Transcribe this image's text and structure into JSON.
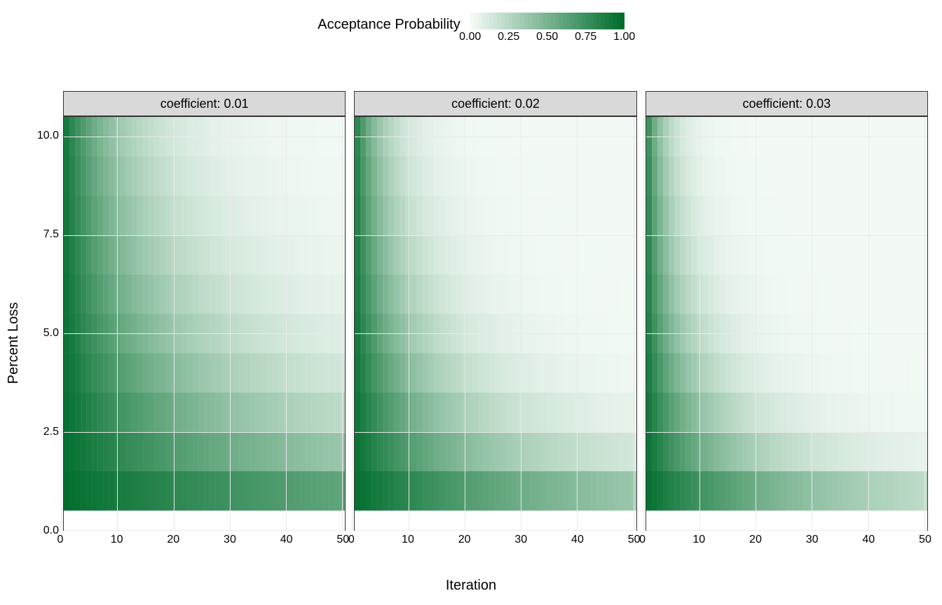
{
  "legend": {
    "title": "Acceptance Probability",
    "ticks": [
      "0.00",
      "0.25",
      "0.50",
      "0.75",
      "1.00"
    ]
  },
  "axes": {
    "ylabel": "Percent Loss",
    "xlabel": "Iteration",
    "yticks": [
      "0.0",
      "2.5",
      "5.0",
      "7.5",
      "10.0"
    ],
    "xticks": [
      "0",
      "10",
      "20",
      "30",
      "40",
      "50"
    ]
  },
  "facets": [
    {
      "label": "coefficient: 0.01",
      "coef": 0.01
    },
    {
      "label": "coefficient: 0.02",
      "coef": 0.02
    },
    {
      "label": "coefficient: 0.03",
      "coef": 0.03
    }
  ],
  "chart_data": {
    "type": "heatmap",
    "xlabel": "Iteration",
    "ylabel": "Percent Loss",
    "zlabel": "Acceptance Probability",
    "x_range": [
      1,
      50
    ],
    "y_values": [
      1,
      2,
      3,
      4,
      5,
      6,
      7,
      8,
      9,
      10
    ],
    "y_axis_limits": [
      0,
      10.5
    ],
    "z_range": [
      0,
      1
    ],
    "formula": "z = exp(-coefficient * x * y)",
    "color_scale": {
      "low": "#f3faf5",
      "high": "#006d2c"
    },
    "panels": [
      {
        "facet": "coefficient: 0.01",
        "coefficient": 0.01,
        "rows": [
          {
            "y": 1,
            "z_at_x1": 0.99,
            "z_at_x10": 0.9,
            "z_at_x25": 0.78,
            "z_at_x50": 0.61
          },
          {
            "y": 2,
            "z_at_x1": 0.98,
            "z_at_x10": 0.82,
            "z_at_x25": 0.61,
            "z_at_x50": 0.37
          },
          {
            "y": 3,
            "z_at_x1": 0.97,
            "z_at_x10": 0.74,
            "z_at_x25": 0.47,
            "z_at_x50": 0.22
          },
          {
            "y": 4,
            "z_at_x1": 0.96,
            "z_at_x10": 0.67,
            "z_at_x25": 0.37,
            "z_at_x50": 0.14
          },
          {
            "y": 5,
            "z_at_x1": 0.95,
            "z_at_x10": 0.61,
            "z_at_x25": 0.29,
            "z_at_x50": 0.08
          },
          {
            "y": 6,
            "z_at_x1": 0.94,
            "z_at_x10": 0.55,
            "z_at_x25": 0.22,
            "z_at_x50": 0.05
          },
          {
            "y": 7,
            "z_at_x1": 0.93,
            "z_at_x10": 0.5,
            "z_at_x25": 0.17,
            "z_at_x50": 0.03
          },
          {
            "y": 8,
            "z_at_x1": 0.92,
            "z_at_x10": 0.45,
            "z_at_x25": 0.14,
            "z_at_x50": 0.02
          },
          {
            "y": 9,
            "z_at_x1": 0.91,
            "z_at_x10": 0.41,
            "z_at_x25": 0.11,
            "z_at_x50": 0.01
          },
          {
            "y": 10,
            "z_at_x1": 0.9,
            "z_at_x10": 0.37,
            "z_at_x25": 0.08,
            "z_at_x50": 0.01
          }
        ]
      },
      {
        "facet": "coefficient: 0.02",
        "coefficient": 0.02,
        "rows": [
          {
            "y": 1,
            "z_at_x1": 0.98,
            "z_at_x10": 0.82,
            "z_at_x25": 0.61,
            "z_at_x50": 0.37
          },
          {
            "y": 2,
            "z_at_x1": 0.96,
            "z_at_x10": 0.67,
            "z_at_x25": 0.37,
            "z_at_x50": 0.14
          },
          {
            "y": 3,
            "z_at_x1": 0.94,
            "z_at_x10": 0.55,
            "z_at_x25": 0.22,
            "z_at_x50": 0.05
          },
          {
            "y": 4,
            "z_at_x1": 0.92,
            "z_at_x10": 0.45,
            "z_at_x25": 0.14,
            "z_at_x50": 0.02
          },
          {
            "y": 5,
            "z_at_x1": 0.9,
            "z_at_x10": 0.37,
            "z_at_x25": 0.08,
            "z_at_x50": 0.01
          },
          {
            "y": 6,
            "z_at_x1": 0.89,
            "z_at_x10": 0.3,
            "z_at_x25": 0.05,
            "z_at_x50": 0.0
          },
          {
            "y": 7,
            "z_at_x1": 0.87,
            "z_at_x10": 0.25,
            "z_at_x25": 0.03,
            "z_at_x50": 0.0
          },
          {
            "y": 8,
            "z_at_x1": 0.85,
            "z_at_x10": 0.2,
            "z_at_x25": 0.02,
            "z_at_x50": 0.0
          },
          {
            "y": 9,
            "z_at_x1": 0.84,
            "z_at_x10": 0.17,
            "z_at_x25": 0.01,
            "z_at_x50": 0.0
          },
          {
            "y": 10,
            "z_at_x1": 0.82,
            "z_at_x10": 0.14,
            "z_at_x25": 0.01,
            "z_at_x50": 0.0
          }
        ]
      },
      {
        "facet": "coefficient: 0.03",
        "coefficient": 0.03,
        "rows": [
          {
            "y": 1,
            "z_at_x1": 0.97,
            "z_at_x10": 0.74,
            "z_at_x25": 0.47,
            "z_at_x50": 0.22
          },
          {
            "y": 2,
            "z_at_x1": 0.94,
            "z_at_x10": 0.55,
            "z_at_x25": 0.22,
            "z_at_x50": 0.05
          },
          {
            "y": 3,
            "z_at_x1": 0.91,
            "z_at_x10": 0.41,
            "z_at_x25": 0.11,
            "z_at_x50": 0.01
          },
          {
            "y": 4,
            "z_at_x1": 0.89,
            "z_at_x10": 0.3,
            "z_at_x25": 0.05,
            "z_at_x50": 0.0
          },
          {
            "y": 5,
            "z_at_x1": 0.86,
            "z_at_x10": 0.22,
            "z_at_x25": 0.02,
            "z_at_x50": 0.0
          },
          {
            "y": 6,
            "z_at_x1": 0.84,
            "z_at_x10": 0.17,
            "z_at_x25": 0.01,
            "z_at_x50": 0.0
          },
          {
            "y": 7,
            "z_at_x1": 0.81,
            "z_at_x10": 0.12,
            "z_at_x25": 0.01,
            "z_at_x50": 0.0
          },
          {
            "y": 8,
            "z_at_x1": 0.79,
            "z_at_x10": 0.09,
            "z_at_x25": 0.0,
            "z_at_x50": 0.0
          },
          {
            "y": 9,
            "z_at_x1": 0.76,
            "z_at_x10": 0.07,
            "z_at_x25": 0.0,
            "z_at_x50": 0.0
          },
          {
            "y": 10,
            "z_at_x1": 0.74,
            "z_at_x10": 0.05,
            "z_at_x25": 0.0,
            "z_at_x50": 0.0
          }
        ]
      }
    ]
  }
}
